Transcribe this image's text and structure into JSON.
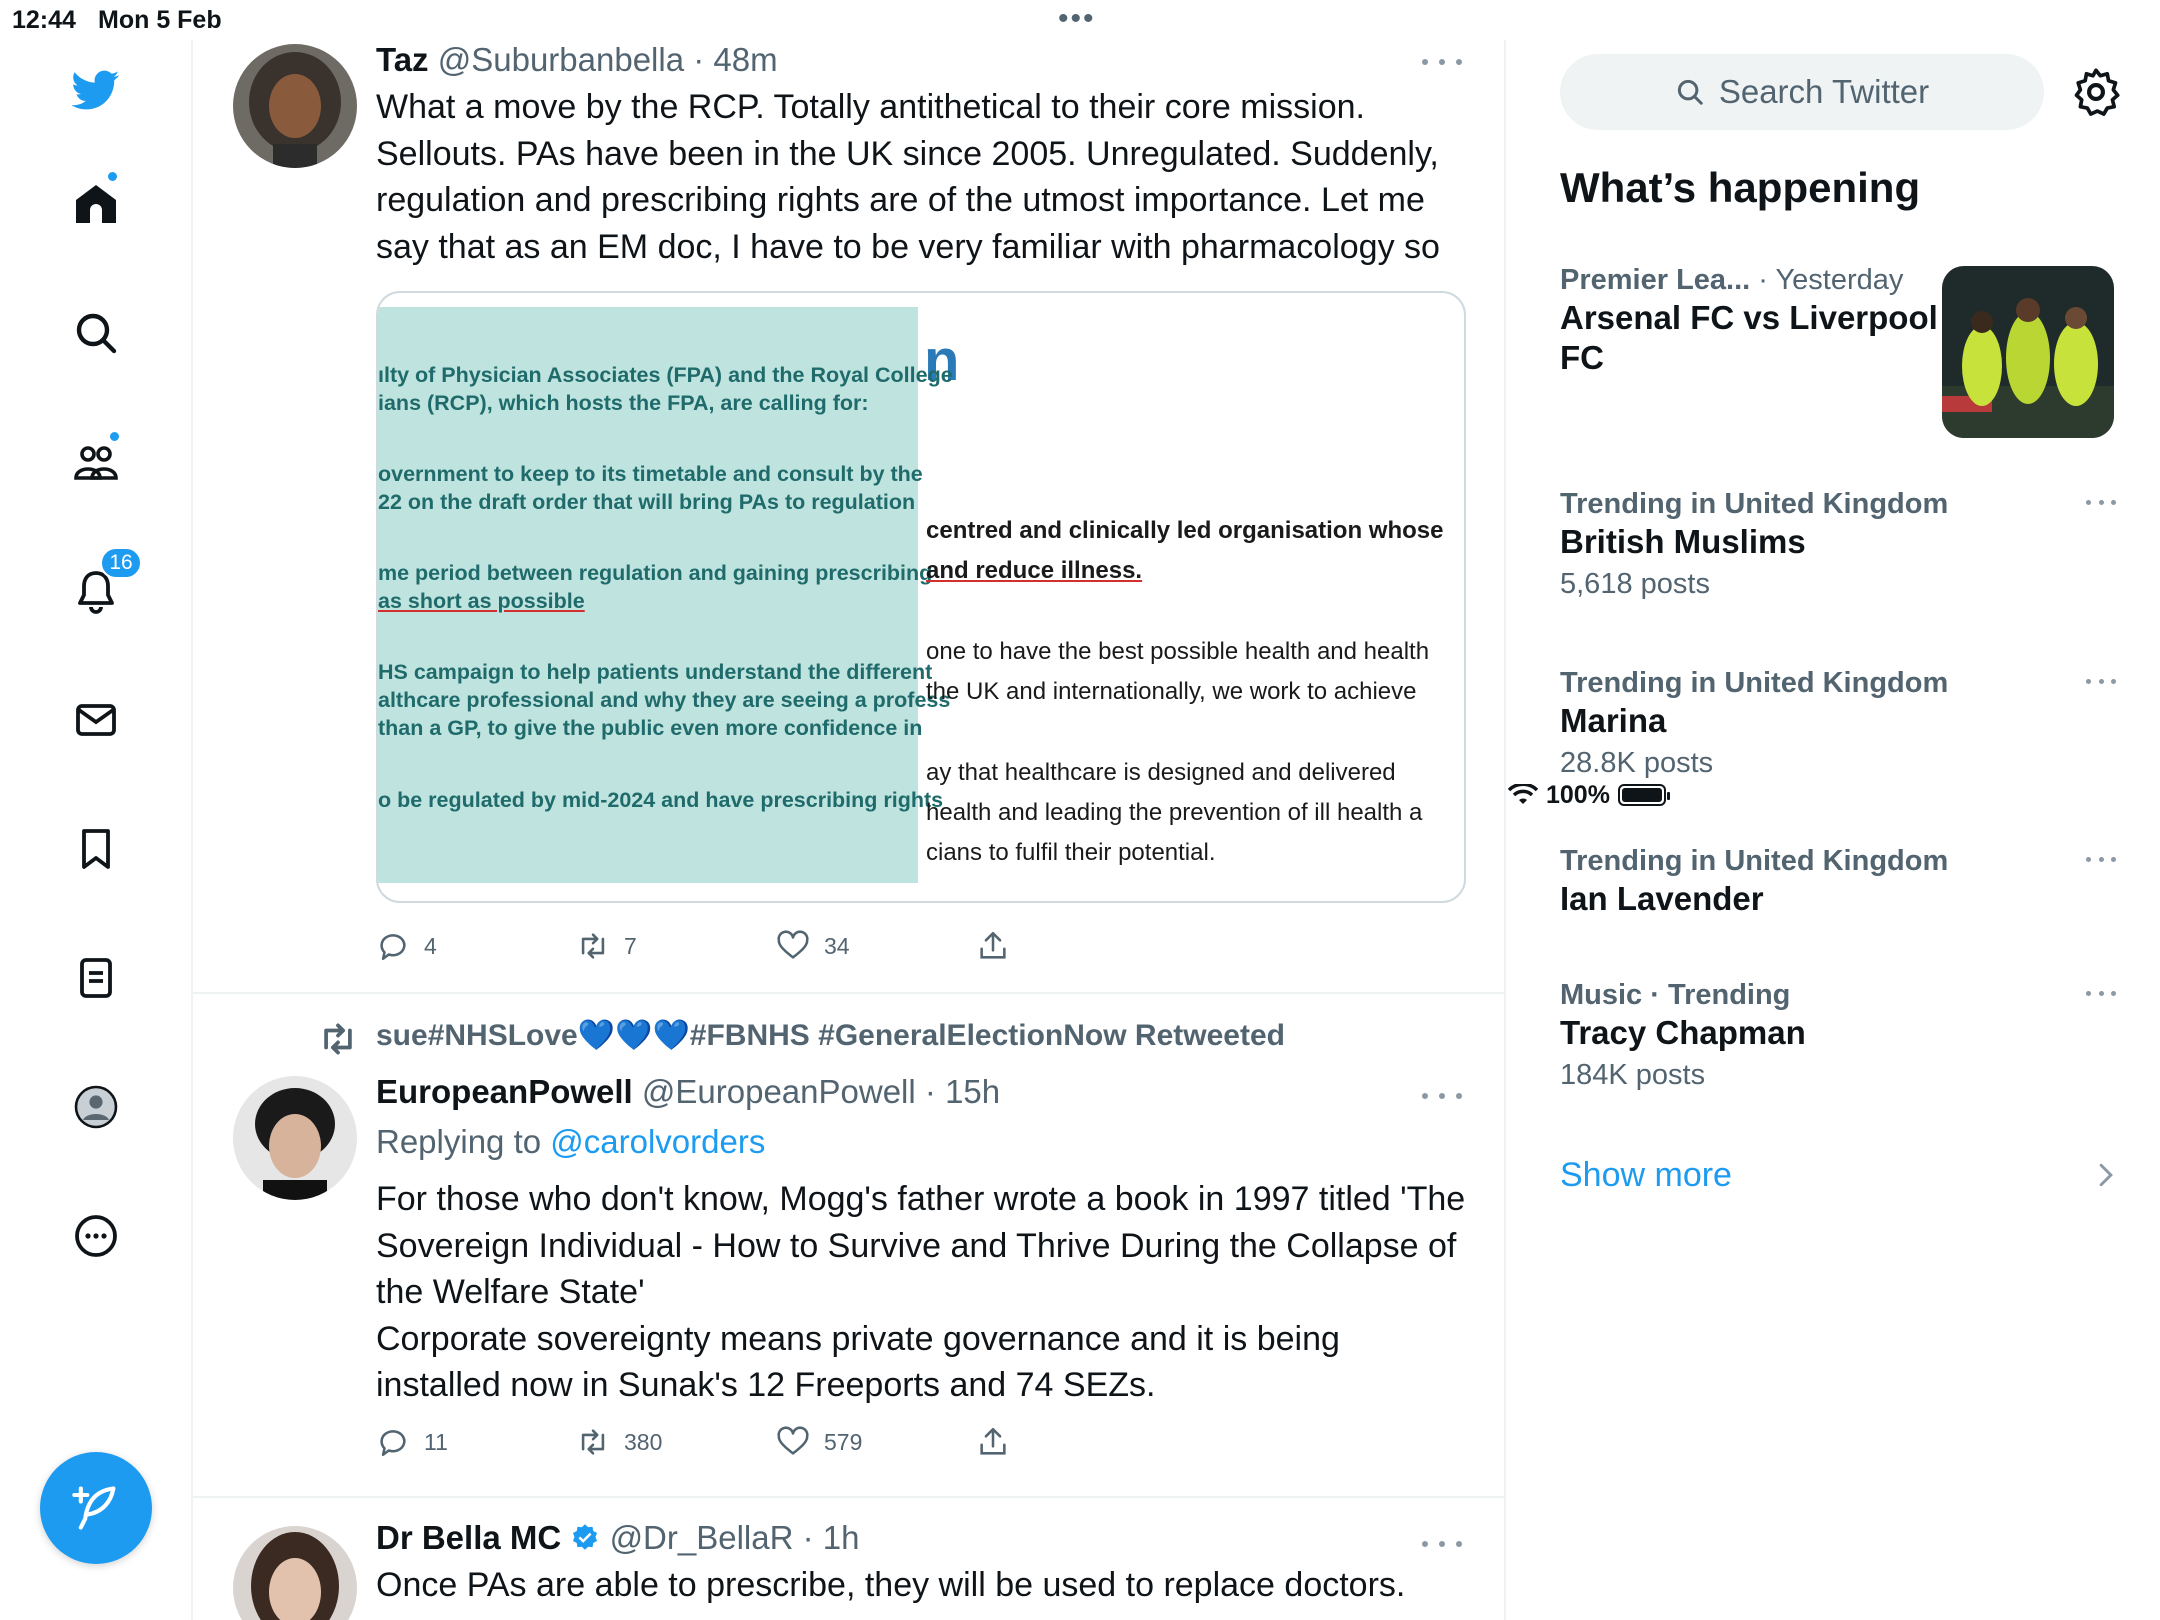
{
  "status_bar": {
    "time": "12:44",
    "date": "Mon 5 Feb",
    "battery": "100%"
  },
  "nav": {
    "notifications_count": "16"
  },
  "tweets": [
    {
      "name": "Taz",
      "handle": "@Suburbanbella",
      "time": "48m",
      "text": "What a move by the RCP. Totally antithetical to their core mission. Sellouts. PAs have been in the UK since 2005. Unregulated. Suddenly, regulation and prescribing rights are of the utmost importance. Let me say that as an EM doc, I have to be very familiar with pharmacology so",
      "media": {
        "big_letter": "n",
        "left_lines": [
          "ılty of Physician Associates (FPA) and the Royal College",
          "ians (RCP), which hosts the FPA, are calling for:",
          "overnment to keep to its timetable and consult by the",
          "22 on the draft order that will bring PAs to regulation",
          "me period between regulation and gaining prescribing",
          " as short as possible",
          "HS campaign to help patients understand the different",
          "althcare professional and why they are seeing a profess",
          " than a GP, to give the public even more confidence in",
          "o be regulated by mid-2024 and have prescribing rights"
        ],
        "right_lines": [
          "centred and clinically led organisation whose",
          " and reduce illness.",
          "one to have the best possible health and health",
          " the UK and internationally, we work to achieve",
          "ay that healthcare is designed and delivered",
          "health and leading the prevention of ill health a",
          "cians to fulfil their potential."
        ]
      },
      "replies": "4",
      "retweets": "7",
      "likes": "34"
    },
    {
      "retweeted_by": "sue#NHSLove💙💙💙#FBNHS #GeneralElectionNow Retweeted",
      "name": "EuropeanPowell",
      "handle": "@EuropeanPowell",
      "time": "15h",
      "reply_prefix": "Replying to",
      "reply_to": "@carolvorders",
      "text": "For those who don't know, Mogg's father wrote a book in 1997 titled 'The Sovereign Individual - How to Survive and Thrive During the Collapse of the Welfare State'",
      "text2": "Corporate sovereignty means private governance and it is being installed now in Sunak's 12 Freeports and 74 SEZs.",
      "replies": "11",
      "retweets": "380",
      "likes": "579"
    },
    {
      "name": "Dr Bella MC",
      "handle": "@Dr_BellaR",
      "time": "1h",
      "text": "Once PAs are able to prescribe, they will be used to replace doctors."
    }
  ],
  "sidebar": {
    "search_placeholder": "Search Twitter",
    "whats_happening": "What’s happening",
    "trends": [
      {
        "context": "Premier Lea...",
        "context_extra": "· Yesterday",
        "title": "Arsenal FC vs Liverpool FC",
        "posts": ""
      },
      {
        "context": "Trending in United Kingdom",
        "title": "British Muslims",
        "posts": "5,618 posts"
      },
      {
        "context": "Trending in United Kingdom",
        "title": "Marina",
        "posts": "28.8K posts"
      },
      {
        "context": "Trending in United Kingdom",
        "title": "Ian Lavender",
        "posts": ""
      },
      {
        "context": "Music · Trending",
        "title": "Tracy Chapman",
        "posts": "184K posts"
      }
    ],
    "show_more": "Show more"
  },
  "colors": {
    "accent": "#1d9bf0",
    "text": "#0f1419",
    "secondary": "#536471",
    "teal_card": "#bfe3df"
  }
}
